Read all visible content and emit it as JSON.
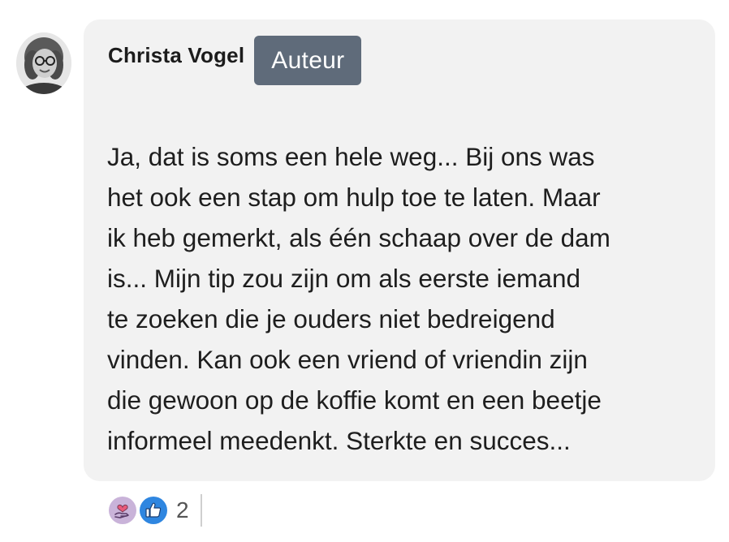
{
  "comment": {
    "author_name": "Christa Vogel",
    "author_badge": "Auteur",
    "body": "Ja, dat is soms een hele weg... Bij ons was\nhet ook een stap om hulp toe te laten. Maar\nik heb gemerkt, als één schaap over de dam\nis... Mijn tip zou zijn om als eerste iemand\nte zoeken die je ouders niet bedreigend\nvinden. Kan ook een vriend of vriendin zijn\ndie gewoon op de koffie komt en een beetje\ninformeel meedenkt. Sterkte en succes...",
    "reactions": {
      "icons": [
        "care-heart-icon",
        "thumbs-up-icon"
      ],
      "count": "2"
    }
  },
  "colors": {
    "bubble_bg": "#f2f2f2",
    "badge_bg": "#5f6b7a",
    "like_blue": "#2f86e0",
    "care_purple": "#c9b3d9"
  }
}
